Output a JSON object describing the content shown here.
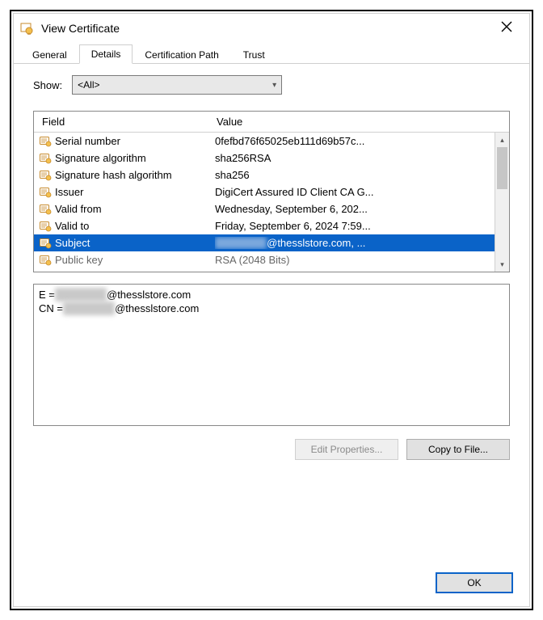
{
  "window": {
    "title": "View Certificate"
  },
  "tabs": [
    {
      "label": "General",
      "active": false
    },
    {
      "label": "Details",
      "active": true
    },
    {
      "label": "Certification Path",
      "active": false
    },
    {
      "label": "Trust",
      "active": false
    }
  ],
  "show": {
    "label": "Show:",
    "selected": "<All>"
  },
  "columns": {
    "field": "Field",
    "value": "Value"
  },
  "fields": [
    {
      "name": "Serial number",
      "value": "0fefbd76f65025eb111d69b57c..."
    },
    {
      "name": "Signature algorithm",
      "value": "sha256RSA"
    },
    {
      "name": "Signature hash algorithm",
      "value": "sha256"
    },
    {
      "name": "Issuer",
      "value": "DigiCert Assured ID Client CA G..."
    },
    {
      "name": "Valid from",
      "value": "Wednesday, September 6, 202..."
    },
    {
      "name": "Valid to",
      "value": "Friday, September 6, 2024 7:59..."
    },
    {
      "name": "Subject",
      "value_redacted_prefix": "xxxxx.xxxx",
      "value_suffix": "@thesslstore.com, ...",
      "selected": true
    },
    {
      "name": "Public key",
      "value": "RSA (2048 Bits)",
      "cutoff": true
    }
  ],
  "detail": {
    "lines": [
      {
        "prefix": "E = ",
        "redacted": "xxxxx.xxxx",
        "suffix": "@thesslstore.com"
      },
      {
        "prefix": "CN = ",
        "redacted": "xxxxx.xxxx",
        "suffix": "@thesslstore.com"
      }
    ]
  },
  "buttons": {
    "edit_properties": "Edit Properties...",
    "copy_to_file": "Copy to File...",
    "ok": "OK"
  }
}
